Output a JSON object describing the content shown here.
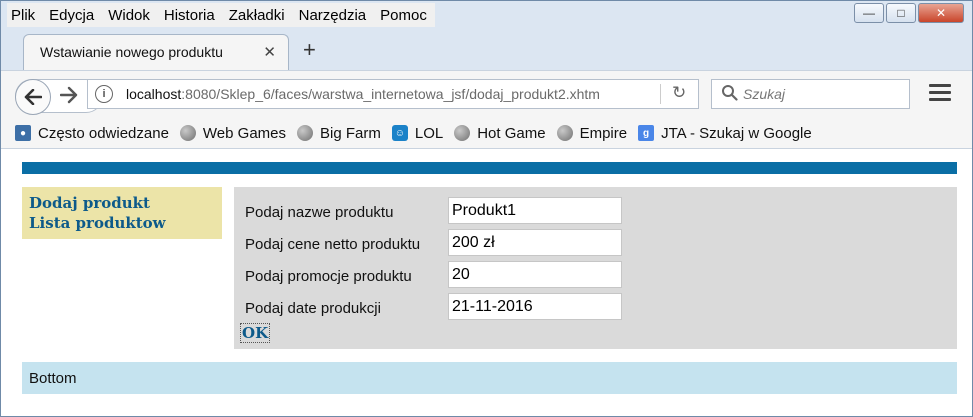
{
  "menu": [
    "Plik",
    "Edycja",
    "Widok",
    "Historia",
    "Zakładki",
    "Narzędzia",
    "Pomoc"
  ],
  "tab": {
    "title": "Wstawianie nowego produktu"
  },
  "urlbar": {
    "host": "localhost",
    "path": ":8080/Sklep_6/faces/warstwa_internetowa_jsf/dodaj_produkt2.xhtm"
  },
  "search": {
    "placeholder": "Szukaj"
  },
  "bookmarks": [
    {
      "label": "Często odwiedzane",
      "icon": "most-visited-icon"
    },
    {
      "label": "Web Games",
      "icon": "globe-icon"
    },
    {
      "label": "Big Farm",
      "icon": "globe-icon"
    },
    {
      "label": "LOL",
      "icon": "lol-icon"
    },
    {
      "label": "Hot Game",
      "icon": "globe-icon"
    },
    {
      "label": "Empire",
      "icon": "globe-icon"
    },
    {
      "label": "JTA - Szukaj w Google",
      "icon": "google-icon"
    }
  ],
  "sidebar": {
    "links": [
      "Dodaj produkt",
      "Lista produktow"
    ]
  },
  "form": {
    "fields": [
      {
        "label": "Podaj nazwe produktu",
        "value": "Produkt1"
      },
      {
        "label": "Podaj cene netto produktu",
        "value": "200 zł"
      },
      {
        "label": "Podaj promocje produktu",
        "value": "20"
      },
      {
        "label": "Podaj date produkcji",
        "value": "21-11-2016"
      }
    ],
    "submit": "OK"
  },
  "footer": {
    "text": "Bottom"
  },
  "colors": {
    "topbar": "#0a6ea5",
    "sidebar": "#ece4a8",
    "panel": "#dadada",
    "footer": "#c5e3ef",
    "link": "#0d5a8a"
  }
}
